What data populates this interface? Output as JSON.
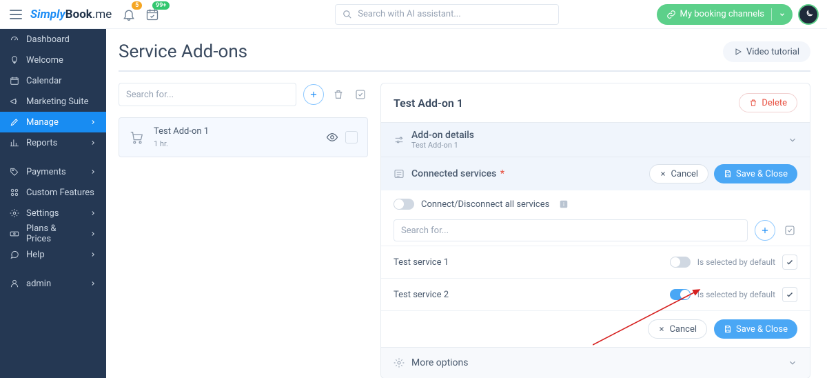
{
  "header": {
    "brand_part1": "Simply",
    "brand_part2": "Book",
    "brand_part3": ".me",
    "bell_badge": "5",
    "cal_badge": "99+",
    "search_placeholder": "Search with AI assistant...",
    "channels_label": "My booking channels"
  },
  "sidebar": {
    "items": [
      {
        "label": "Dashboard"
      },
      {
        "label": "Welcome"
      },
      {
        "label": "Calendar"
      },
      {
        "label": "Marketing Suite"
      },
      {
        "label": "Manage"
      },
      {
        "label": "Reports"
      },
      {
        "label": "Payments"
      },
      {
        "label": "Custom Features"
      },
      {
        "label": "Settings"
      },
      {
        "label": "Plans & Prices"
      },
      {
        "label": "Help"
      }
    ],
    "user_label": "admin"
  },
  "page": {
    "title": "Service Add-ons",
    "video_tutorial": "Video tutorial"
  },
  "left": {
    "search_placeholder": "Search for...",
    "addon": {
      "title": "Test Add-on 1",
      "duration": "1 hr."
    }
  },
  "right": {
    "title": "Test Add-on 1",
    "delete": "Delete",
    "details": {
      "label": "Add-on details",
      "sub": "Test Add-on 1"
    },
    "connected": {
      "label": "Connected services",
      "cancel": "Cancel",
      "save": "Save & Close"
    },
    "toggle_all": "Connect/Disconnect all services",
    "inner_search_placeholder": "Search for...",
    "services": [
      {
        "name": "Test service 1",
        "default_label": "Is selected by default",
        "on": false
      },
      {
        "name": "Test service 2",
        "default_label": "Is selected by default",
        "on": true
      }
    ],
    "footer": {
      "cancel": "Cancel",
      "save": "Save & Close"
    },
    "more": "More options"
  }
}
